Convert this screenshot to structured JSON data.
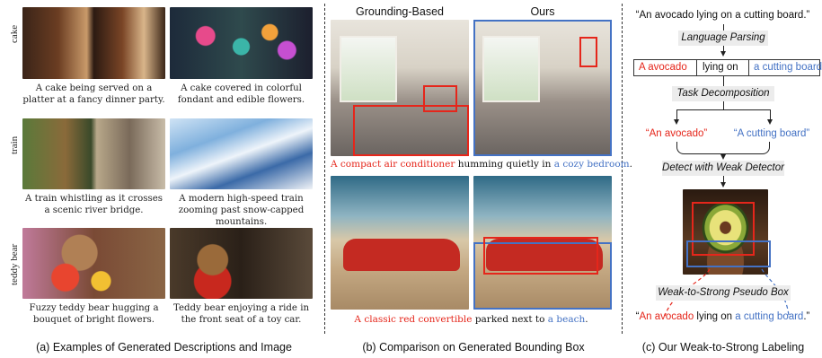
{
  "panel_a": {
    "rows": [
      {
        "label": "cake",
        "captions": [
          "A cake being served on a platter at a fancy dinner party.",
          "A cake covered in colorful fondant and edible flowers."
        ]
      },
      {
        "label": "train",
        "captions": [
          "A train whistling as it crosses a scenic river bridge.",
          "A modern high-speed train zooming past snow-capped mountains."
        ]
      },
      {
        "label": "teddy bear",
        "captions": [
          "Fuzzy teddy bear hugging a bouquet of bright flowers.",
          "Teddy bear enjoying a ride in the front seat of a toy car."
        ]
      }
    ],
    "title": "(a) Examples of Generated Descriptions and Image"
  },
  "panel_b": {
    "col_grounding": "Grounding-Based",
    "col_ours": "Ours",
    "cap1": {
      "red": "A compact air conditioner",
      "mid": " humming quietly in ",
      "blue": "a cozy bedroom",
      "end": "."
    },
    "cap2": {
      "red": "A classic red convertible",
      "mid": " parked next to ",
      "blue": "a beach",
      "end": "."
    },
    "title": "(b) Comparison on Generated Bounding Box"
  },
  "panel_c": {
    "prompt": "“An avocado lying on a cutting board.”",
    "step_parse": "Language Parsing",
    "parse_red": "A avocado",
    "parse_mid": "lying on",
    "parse_blue": "a cutting board.",
    "step_decomp": "Task Decomposition",
    "entity_red": "“An avocado”",
    "entity_blue": "“A cutting board”",
    "step_detect": "Detect with Weak Detector",
    "step_pseudo": "Weak-to-Strong Pseudo Box",
    "final_red": "An avocado",
    "final_mid": " lying on ",
    "final_blue": "a cutting board",
    "final_open": "“",
    "final_end": ".”",
    "title": "(c) Our Weak-to-Strong Labeling"
  },
  "colors": {
    "red": "#e5261b",
    "blue": "#4472c4"
  }
}
